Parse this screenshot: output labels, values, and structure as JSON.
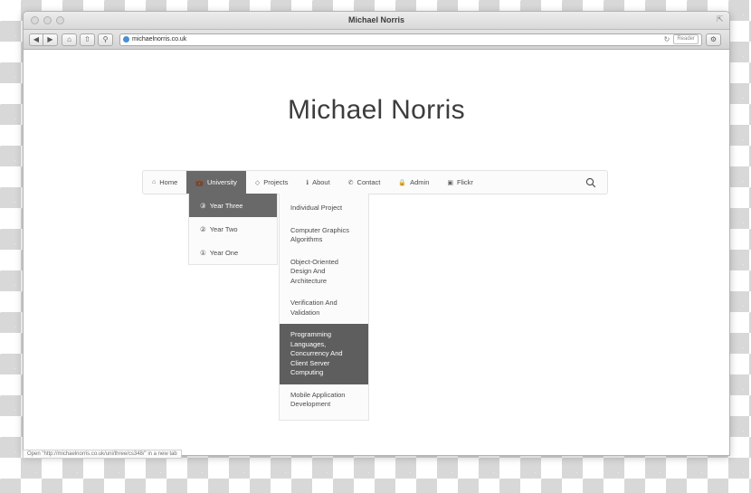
{
  "window": {
    "title": "Michael Norris",
    "traffic_lights": [
      "close",
      "minimize",
      "zoom"
    ],
    "resize_icon": "resize-icon"
  },
  "toolbar": {
    "back_label": "◀",
    "forward_label": "▶",
    "home_icon": "home-icon",
    "share_icon": "share-icon",
    "bookmark_icon": "bookmark-icon",
    "url": "michaelnorris.co.uk",
    "reload_label": "↻",
    "reader_label": "Reader",
    "settings_icon": "gear-icon"
  },
  "page": {
    "heading": "Michael Norris",
    "nav": {
      "items": [
        {
          "label": "Home",
          "icon": "home-icon",
          "active": false
        },
        {
          "label": "University",
          "icon": "briefcase-icon",
          "active": true
        },
        {
          "label": "Projects",
          "icon": "tag-icon",
          "active": false
        },
        {
          "label": "About",
          "icon": "info-icon",
          "active": false
        },
        {
          "label": "Contact",
          "icon": "phone-icon",
          "active": false
        },
        {
          "label": "Admin",
          "icon": "lock-icon",
          "active": false
        },
        {
          "label": "Flickr",
          "icon": "camera-icon",
          "active": false
        }
      ],
      "search_icon": "search-icon"
    },
    "years_menu": [
      {
        "label": "Year Three",
        "number": "③",
        "active": true
      },
      {
        "label": "Year Two",
        "number": "②",
        "active": false
      },
      {
        "label": "Year One",
        "number": "①",
        "active": false
      }
    ],
    "modules_menu": [
      {
        "label": "Individual Project",
        "active": false
      },
      {
        "label": "Computer Graphics Algorithms",
        "active": false
      },
      {
        "label": "Object-Oriented Design And Architecture",
        "active": false
      },
      {
        "label": "Verification And Validation",
        "active": false
      },
      {
        "label": "Programming Languages, Concurrency And Client Server Computing",
        "active": true
      },
      {
        "label": "Mobile Application Development",
        "active": false
      }
    ]
  },
  "status_bar": {
    "text": "Open \"http://michaelnorris.co.uk/uni/three/cs348/\" in a new tab"
  },
  "colors": {
    "active_nav": "#696969",
    "active_module": "#5e5e5e",
    "menu_bg": "#fbfbfb",
    "text": "#4a4a4a"
  }
}
